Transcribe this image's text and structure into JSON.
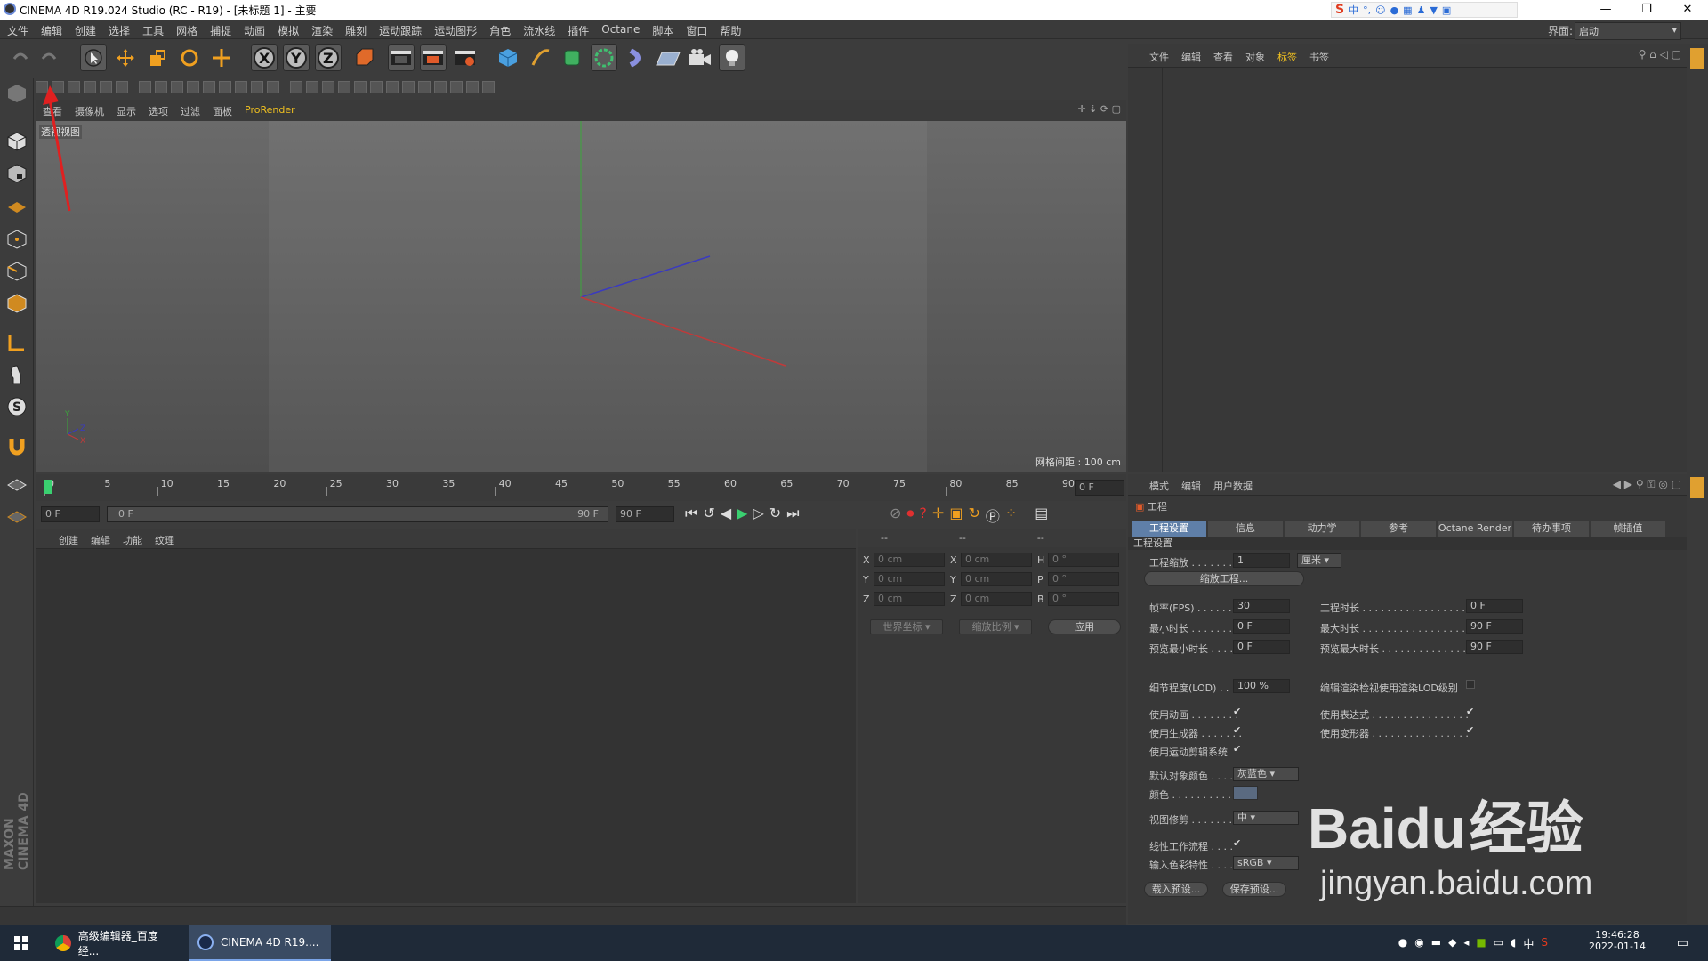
{
  "window": {
    "title": "CINEMA 4D R19.024 Studio (RC - R19) - [未标题 1] - 主要"
  },
  "ime": {
    "brand": "S",
    "mode": "中"
  },
  "menu": [
    "文件",
    "编辑",
    "创建",
    "选择",
    "工具",
    "网格",
    "捕捉",
    "动画",
    "模拟",
    "渲染",
    "雕刻",
    "运动跟踪",
    "运动图形",
    "角色",
    "流水线",
    "插件",
    "Octane",
    "脚本",
    "窗口",
    "帮助"
  ],
  "interface": {
    "label": "界面:",
    "value": "启动"
  },
  "viewport": {
    "menu": [
      "查看",
      "摄像机",
      "显示",
      "选项",
      "过滤",
      "面板",
      "ProRender"
    ],
    "label": "透视视图",
    "grid_info": "网格间距 : 100 cm"
  },
  "timeline": {
    "ticks": [
      "0",
      "5",
      "10",
      "15",
      "20",
      "25",
      "30",
      "35",
      "40",
      "45",
      "50",
      "55",
      "60",
      "65",
      "70",
      "75",
      "80",
      "85",
      "90"
    ],
    "current": "0 F"
  },
  "playback": {
    "start": "0 F",
    "range_start": "0 F",
    "range_end": "90 F",
    "end": "90 F"
  },
  "materials": {
    "menu": [
      "创建",
      "编辑",
      "功能",
      "纹理"
    ]
  },
  "coords": {
    "headers": [
      "--",
      "--",
      "--"
    ],
    "rows": [
      {
        "a": "X",
        "av": "0 cm",
        "b": "X",
        "bv": "0 cm",
        "c": "H",
        "cv": "0 °"
      },
      {
        "a": "Y",
        "av": "0 cm",
        "b": "Y",
        "bv": "0 cm",
        "c": "P",
        "cv": "0 °"
      },
      {
        "a": "Z",
        "av": "0 cm",
        "b": "Z",
        "bv": "0 cm",
        "c": "B",
        "cv": "0 °"
      }
    ],
    "world": "世界坐标",
    "scale": "缩放比例",
    "apply": "应用"
  },
  "objects": {
    "menu": [
      "文件",
      "编辑",
      "查看",
      "对象",
      "标签",
      "书签"
    ]
  },
  "attributes": {
    "menu": [
      "模式",
      "编辑",
      "用户数据"
    ],
    "object": "工程",
    "tabs": [
      "工程设置",
      "信息",
      "动力学",
      "参考",
      "Octane Render",
      "待办事项",
      "帧插值"
    ],
    "section": "工程设置",
    "scale_label": "工程缩放 . . . . . . .",
    "scale_value": "1",
    "scale_unit": "厘米",
    "scale_btn": "缩放工程...",
    "fps_label": "帧率(FPS) . . . . . .",
    "fps_value": "30",
    "duration_label": "工程时长 . . . . . . . . . . . . . . . . . .",
    "duration_value": "0 F",
    "min_label": "最小时长 . . . . . . .",
    "min_value": "0 F",
    "max_label": "最大时长 . . . . . . . . . . . . . . . . . .",
    "max_value": "90 F",
    "pmin_label": "预览最小时长 . . . .",
    "pmin_value": "0 F",
    "pmax_label": "预览最大时长 . . . . . . . . . . . . . . .",
    "pmax_value": "90 F",
    "lod_label": "细节程度(LOD) . . . .",
    "lod_value": "100 %",
    "lod_render_label": "编辑渲染检视使用渲染LOD级别",
    "use_anim": "使用动画 . . . . . . . .",
    "use_expr": "使用表达式 . . . . . . . . . . . . . . . .",
    "use_gen": "使用生成器 . . . . . . .",
    "use_deform": "使用变形器 . . . . . . . . . . . . . . . .",
    "use_motion": "使用运动剪辑系统",
    "def_color_label": "默认对象颜色 . . . .",
    "def_color_value": "灰蓝色",
    "color_label": "颜色 . . . . . . . . . .",
    "clip_label": "视图修剪 . . . . . . .",
    "clip_value": "中",
    "linear_label": "线性工作流程 . . . .",
    "input_label": "输入色彩特性 . . . .",
    "input_value": "sRGB",
    "load_preset": "载入预设...",
    "save_preset": "保存预设..."
  },
  "taskbar": {
    "apps": [
      {
        "label": "高级编辑器_百度经..."
      },
      {
        "label": "CINEMA 4D R19...."
      }
    ],
    "time": "19:46:28",
    "date": "2022-01-14",
    "ime": "中"
  },
  "watermark": {
    "brand": "Bai",
    "brand2": "du",
    "cn": "经验",
    "url": "jingyan.baidu.com"
  },
  "brand_side": "MAXON CINEMA 4D",
  "colors": {
    "accent": "#5f7fa8",
    "axis_x": "#c03a3a",
    "axis_y": "#3aa83a",
    "axis_z": "#3a3ac0",
    "highlight_tab": "#f0c020",
    "arrow": "#e02020"
  }
}
